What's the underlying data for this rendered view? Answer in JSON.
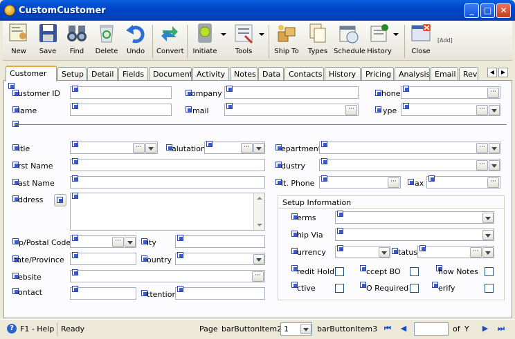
{
  "window": {
    "title": "CustomCustomer"
  },
  "toolbar": {
    "new": "New",
    "save": "Save",
    "find": "Find",
    "delete": "Delete",
    "undo": "Undo",
    "convert": "Convert",
    "initiate": "Initiate",
    "tools": "Tools",
    "ship_to": "Ship To",
    "types": "Types",
    "schedule": "Schedule",
    "history": "History",
    "close": "Close",
    "add": "[Add]"
  },
  "tabs": [
    "Customer",
    "Setup",
    "Detail",
    "Fields",
    "Documents",
    "Activity",
    "Notes",
    "Data",
    "Contacts",
    "History",
    "Pricing",
    "Analysis",
    "Email",
    "Rev"
  ],
  "form": {
    "customer_id": "ustomer ID",
    "company": "ompany",
    "phone": "hone",
    "name": "lame",
    "email": "mail",
    "type": "ype",
    "title": "itle",
    "salutation": "alutation",
    "department": "epartment",
    "first_name": "rst Name",
    "industry": "dustry",
    "last_name": "ast Name",
    "alt_phone": "lt. Phone",
    "fax": "ax",
    "address": "ddress",
    "zip": "p/Postal Code",
    "city": "ity",
    "state": "tate/Province",
    "country": "ountry",
    "website": "ebsite",
    "contact": "ontact",
    "attention": "ttention"
  },
  "setup": {
    "legend": "Setup Information",
    "terms": "erms",
    "ship_via": "hip Via",
    "currency": "urrency",
    "status": "tatus",
    "credit_hold": "redit Hold",
    "accept_bo": "ccept BO",
    "show_notes": "how Notes",
    "active": "ctive",
    "po_required": "O Required",
    "verify": "erify"
  },
  "statusbar": {
    "help": "F1 - Help",
    "ready": "Ready",
    "page": "Page",
    "bar2": "barButtonItem2",
    "page_num": "1",
    "bar3": "barButtonItem3",
    "of": "of",
    "total": "Y"
  }
}
